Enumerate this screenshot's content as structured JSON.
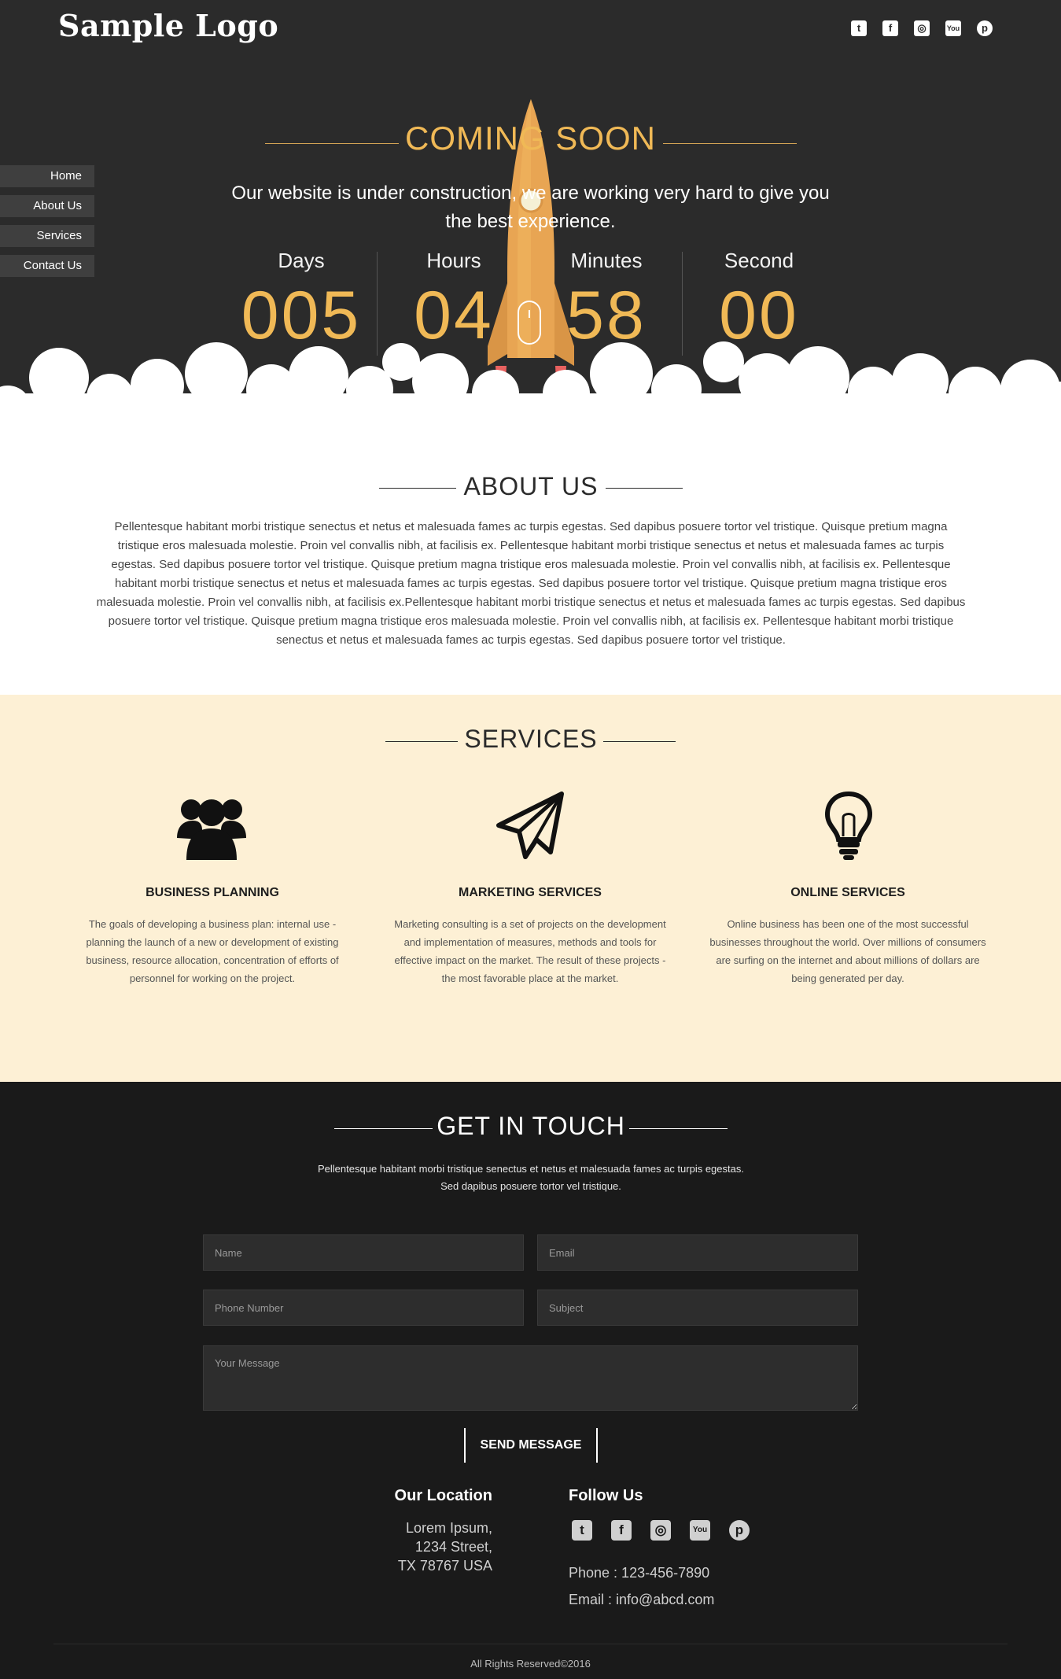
{
  "header": {
    "logo": "Sample Logo",
    "social": [
      {
        "icon": "twitter-icon",
        "glyph": "t"
      },
      {
        "icon": "facebook-icon",
        "glyph": "f"
      },
      {
        "icon": "instagram-icon",
        "glyph": "◎"
      },
      {
        "icon": "youtube-icon",
        "glyph": "You"
      },
      {
        "icon": "pinterest-icon",
        "glyph": "p"
      }
    ]
  },
  "nav": {
    "items": [
      "Home",
      "About Us",
      "Services",
      "Contact Us"
    ]
  },
  "hero": {
    "title": "COMING SOON",
    "subtitle_line1": "Our website is under construction, we are working very hard to give you",
    "subtitle_line2": "the best experience.",
    "countdown": {
      "days_label": "Days",
      "days_value": "005",
      "hours_label": "Hours",
      "hours_value": "04",
      "minutes_label": "Minutes",
      "minutes_value": "58",
      "second_label": "Second",
      "second_value": "00"
    }
  },
  "about": {
    "title": "ABOUT US",
    "lines": [
      "Pellentesque habitant morbi tristique senectus et netus et malesuada fames ac turpis egestas. Sed dapibus posuere tortor vel tristique. Quisque pretium magna",
      "tristique eros malesuada molestie. Proin vel convallis nibh, at facilisis ex. Pellentesque habitant morbi tristique senectus et netus et malesuada fames ac turpis",
      "egestas. Sed dapibus posuere tortor vel tristique. Quisque pretium magna tristique eros malesuada molestie. Proin vel convallis nibh, at facilisis ex. Pellentesque",
      "habitant morbi tristique senectus et netus et malesuada fames ac turpis egestas. Sed dapibus posuere tortor vel tristique. Quisque pretium magna tristique eros",
      "malesuada molestie. Proin vel convallis nibh, at facilisis ex.Pellentesque habitant morbi tristique senectus et netus et malesuada fames ac turpis egestas. Sed dapibus",
      "posuere tortor vel tristique. Quisque pretium magna tristique eros malesuada molestie. Proin vel convallis nibh, at facilisis ex. Pellentesque habitant morbi tristique",
      "senectus et netus et malesuada fames ac turpis egestas. Sed dapibus posuere tortor vel tristique."
    ]
  },
  "services": {
    "title": "SERVICES",
    "items": [
      {
        "icon": "users-group-icon",
        "title": "BUSINESS PLANNING",
        "text": "The goals of developing a business plan: internal use - planning the launch of a new or development of existing business, resource allocation, concentration of efforts of personnel for working on the project."
      },
      {
        "icon": "paper-plane-icon",
        "title": "MARKETING SERVICES",
        "text": "Marketing consulting is a set of projects on the development and implementation of measures, methods and tools for effective impact on the market. The result of these projects - the most favorable place at the market."
      },
      {
        "icon": "lightbulb-icon",
        "title": "ONLINE SERVICES",
        "text": "Online business has been one of the most successful businesses throughout the world. Over millions of consumers are surfing on the internet and about millions of dollars are being generated per day."
      }
    ]
  },
  "contact": {
    "title": "GET IN TOUCH",
    "intro_line1": "Pellentesque habitant morbi tristique senectus et netus et malesuada fames ac turpis egestas.",
    "intro_line2": "Sed dapibus posuere tortor vel tristique.",
    "form": {
      "name_placeholder": "Name",
      "email_placeholder": "Email",
      "phone_placeholder": "Phone Number",
      "subject_placeholder": "Subject",
      "message_placeholder": "Your Message",
      "send_label": "SEND MESSAGE"
    },
    "location": {
      "heading": "Our Location",
      "line1": "Lorem Ipsum,",
      "line2": "1234 Street,",
      "line3": "TX 78767 USA"
    },
    "follow": {
      "heading": "Follow Us",
      "phone": "Phone : 123-456-7890",
      "email": "Email : info@abcd.com"
    },
    "copyright": "All Rights Reserved©2016"
  },
  "colors": {
    "dark_bg": "#2b2b2b",
    "accent": "#f0b956",
    "services_bg": "#fdf0d5",
    "footer_bg": "#1a1a1a"
  }
}
